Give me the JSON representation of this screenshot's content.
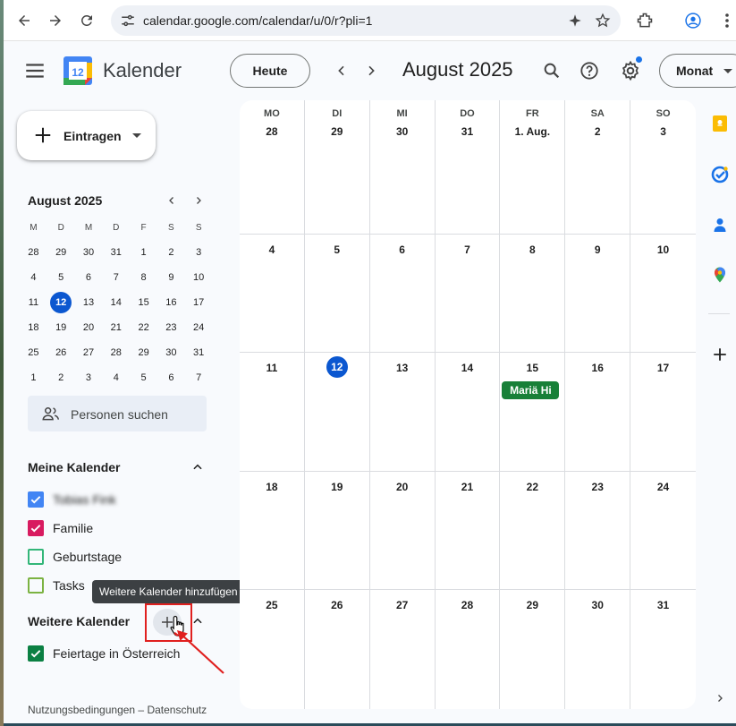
{
  "browser": {
    "url": "calendar.google.com/calendar/u/0/r?pli=1"
  },
  "header": {
    "app_name": "Kalender",
    "logo_day": "12",
    "today_label": "Heute",
    "month_title": "August 2025",
    "view_label": "Monat"
  },
  "create": {
    "label": "Eintragen"
  },
  "mini_calendar": {
    "title": "August 2025",
    "weekdays": [
      "M",
      "D",
      "M",
      "D",
      "F",
      "S",
      "S"
    ],
    "weeks": [
      [
        "28",
        "29",
        "30",
        "31",
        "1",
        "2",
        "3"
      ],
      [
        "4",
        "5",
        "6",
        "7",
        "8",
        "9",
        "10"
      ],
      [
        "11",
        "12",
        "13",
        "14",
        "15",
        "16",
        "17"
      ],
      [
        "18",
        "19",
        "20",
        "21",
        "22",
        "23",
        "24"
      ],
      [
        "25",
        "26",
        "27",
        "28",
        "29",
        "30",
        "31"
      ],
      [
        "1",
        "2",
        "3",
        "4",
        "5",
        "6",
        "7"
      ]
    ],
    "today_week": 2,
    "today_col": 1
  },
  "people_search": {
    "label": "Personen suchen"
  },
  "my_calendars": {
    "title": "Meine Kalender",
    "items": [
      {
        "label": "Tobias Fink",
        "color": "#4285f4",
        "checked": true,
        "blurred": true
      },
      {
        "label": "Familie",
        "color": "#d81b60",
        "checked": true,
        "blurred": false
      },
      {
        "label": "Geburtstage",
        "color": "#33b679",
        "checked": false,
        "blurred": false
      },
      {
        "label": "Tasks",
        "color": "#7cb342",
        "checked": false,
        "blurred": false
      }
    ]
  },
  "other_calendars": {
    "title": "Weitere Kalender",
    "tooltip": "Weitere Kalender hinzufügen",
    "items": [
      {
        "label": "Feiertage in Österreich",
        "color": "#0b8043",
        "checked": true
      }
    ]
  },
  "footer": {
    "text": "Nutzungsbedingungen – Datenschutz"
  },
  "month_grid": {
    "weekdays": [
      "MO",
      "DI",
      "MI",
      "DO",
      "FR",
      "SA",
      "SO"
    ],
    "weeks": [
      [
        "28",
        "29",
        "30",
        "31",
        "1. Aug.",
        "2",
        "3"
      ],
      [
        "4",
        "5",
        "6",
        "7",
        "8",
        "9",
        "10"
      ],
      [
        "11",
        "12",
        "13",
        "14",
        "15",
        "16",
        "17"
      ],
      [
        "18",
        "19",
        "20",
        "21",
        "22",
        "23",
        "24"
      ],
      [
        "25",
        "26",
        "27",
        "28",
        "29",
        "30",
        "31"
      ]
    ],
    "today_week": 2,
    "today_col": 1,
    "events": [
      {
        "week": 2,
        "col": 4,
        "label": "Mariä Hi",
        "color": "#188038"
      }
    ]
  },
  "colors": {
    "accent": "#0b57d0",
    "background": "#f8fafd"
  }
}
